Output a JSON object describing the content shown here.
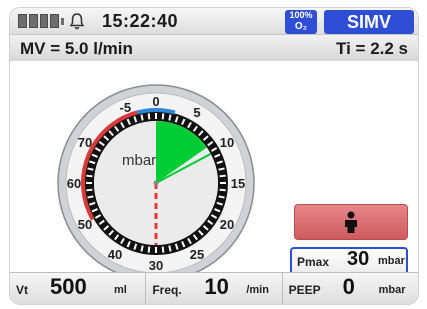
{
  "status_bar": {
    "time": "15:22:40",
    "o2": {
      "percent": "100%",
      "label": "O₂"
    },
    "mode": "SIMV"
  },
  "info_bar": {
    "mv": "MV = 5.0 l/min",
    "ti": "Ti = 2.2 s"
  },
  "gauge": {
    "unit": "mbar",
    "ticks": [
      "-5",
      "0",
      "5",
      "10",
      "15",
      "20",
      "25",
      "30",
      "40",
      "50",
      "60",
      "70"
    ],
    "current_value": 30,
    "colors": {
      "red": "#d93a3a",
      "blue": "#2d87d8",
      "green": "#00cc33",
      "dash": "#e23b3b"
    }
  },
  "controls": {
    "pmax": {
      "label": "Pmax",
      "value": "30",
      "unit": "mbar"
    }
  },
  "params": [
    {
      "label": "Vt",
      "value": "500",
      "unit": "ml"
    },
    {
      "label": "Freq.",
      "value": "10",
      "unit": "/min"
    },
    {
      "label": "PEEP",
      "value": "0",
      "unit": "mbar"
    }
  ]
}
